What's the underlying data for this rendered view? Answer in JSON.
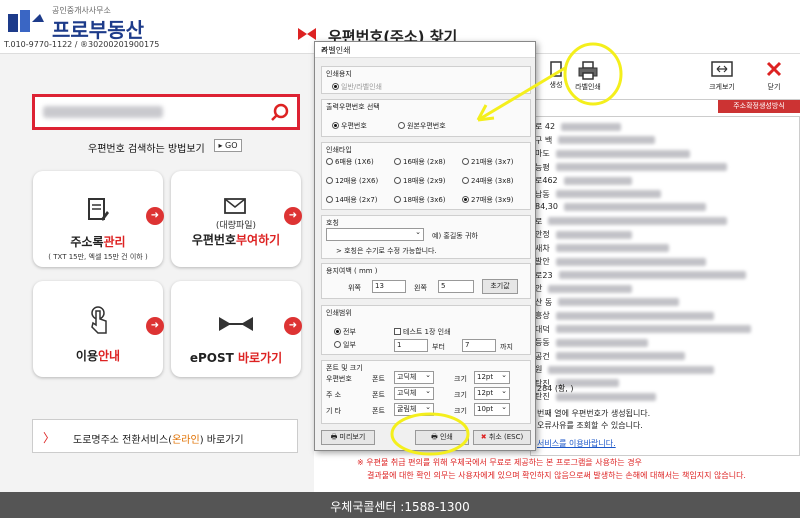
{
  "header": {
    "logo_small": "공인중개사사무소",
    "logo_main": "프로부동산",
    "contact": "T.010-9770-1122 / ®30200201900175",
    "app_title": "우편번호(주소) 찾기"
  },
  "left": {
    "how_to": "우편번호 검색하는 방법보기",
    "go": "GO",
    "tiles": [
      {
        "title_a": "주소록",
        "title_b": "관리",
        "sub": "( TXT 15만, 엑셀 15만 건 이하 )"
      },
      {
        "pre": "(대량파일)",
        "title_a": "우편번호",
        "title_b": "부여하기"
      },
      {
        "title_a": "이용",
        "title_b": "안내"
      },
      {
        "title_a": "ePOST ",
        "title_b": "바로가기"
      }
    ],
    "road_a": "도로명주소 전환서비스(",
    "road_b": "온라인",
    "road_c": ") 바로가기"
  },
  "footer": "우체국콜센터 :1588-1300",
  "toolbar": {
    "gen_label": "생성",
    "label_print": "라벨인쇄",
    "zoom": "크게보기",
    "close": "닫기",
    "red_tab": "주소확정생성방식"
  },
  "list_frag": [
    "로 42",
    "구 백",
    "마도",
    "능평",
    "로462",
    "남동",
    "84,30",
    "로",
    "안정",
    "새차",
    "발안",
    "로23",
    "안",
    "산 동",
    "흥상",
    "대덕",
    "등동",
    "공건",
    "원",
    "탄진",
    "탄진"
  ],
  "notes": [
    "284 (황,        )",
    "번째 열에 우편번호가 생성됩니다.",
    "오류사유를 조회할 수 있습니다.",
    "서비스를 이용바랍니다.",
    "※ 우편물 취급 편의를 위해 우체국에서 무료로 제공하는 본 프로그램을 사용하는 경우",
    "결과물에 대한 확인 의무는 사용자에게 있으며 확인하지 않음으로써 발생하는 손해에 대해서는 책임지지 않습니다."
  ],
  "dialog": {
    "title": "라벨인쇄",
    "g1_title": "인쇄용지",
    "g1_opt": "일반/라벨인쇄",
    "g2_title": "출력우편번호 선택",
    "g2_opts": [
      "우편번호",
      "원본우편번호"
    ],
    "g3_title": "인쇄타입",
    "g3_opts": [
      "6매용 (1X6)",
      "16매용 (2x8)",
      "21매용 (3x7)",
      "12매용 (2X6)",
      "18매용 (2x9)",
      "24매용 (3x8)",
      "14매용 (2x7)",
      "18매용 (3x6)",
      "27매용 (3x9)"
    ],
    "g4_title": "호칭",
    "g4_example": "예) 홍길동 귀하",
    "g4_note": "> 호칭은 수기로 수정 가능합니다.",
    "g5_title": "용지여백 ( mm )",
    "g5_top_lbl": "위쪽",
    "g5_top": "13",
    "g5_left_lbl": "왼쪽",
    "g5_left": "5",
    "g5_reset": "초기값",
    "g6_title": "인쇄범위",
    "g6_all": "전부",
    "g6_part": "일부",
    "g6_test": "테스트 1장 인쇄",
    "g6_from": "1",
    "g6_from_lbl": "부터",
    "g6_to": "7",
    "g6_to_lbl": "까지",
    "g7_title": "폰트 및 크기",
    "g7_rows": [
      {
        "name": "우편번호",
        "font_lbl": "폰트",
        "font": "고딕체",
        "size_lbl": "크기",
        "size": "12pt"
      },
      {
        "name": "주      소",
        "font_lbl": "폰트",
        "font": "고딕체",
        "size_lbl": "크기",
        "size": "12pt"
      },
      {
        "name": "기      타",
        "font_lbl": "폰트",
        "font": "굴림체",
        "size_lbl": "크기",
        "size": "10pt"
      }
    ],
    "btn_preview": "미리보기",
    "btn_print": "인쇄",
    "btn_cancel": "취소 (ESC)"
  }
}
